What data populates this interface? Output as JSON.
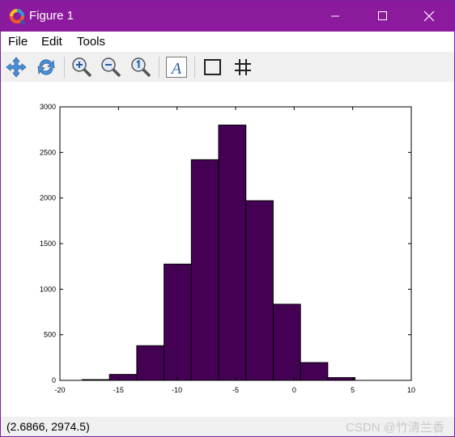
{
  "window": {
    "title": "Figure 1",
    "colors": {
      "titlebar": "#8b1a9c",
      "bar_fill": "#440154"
    }
  },
  "menu": {
    "file": "File",
    "edit": "Edit",
    "tools": "Tools"
  },
  "toolbar": {
    "icons": [
      "pan-icon",
      "rotate-icon",
      "zoom-in-icon",
      "zoom-out-icon",
      "zoom-reset-icon",
      "text-icon",
      "box-icon",
      "grid-icon"
    ]
  },
  "status": {
    "coordinates": "(2.6866, 2974.5)",
    "watermark": "CSDN @竹清兰香"
  },
  "chart_data": {
    "type": "bar",
    "title": "",
    "xlabel": "",
    "ylabel": "",
    "xlim": [
      -20,
      10
    ],
    "ylim": [
      0,
      3000
    ],
    "x_ticks": [
      "-20",
      "-15",
      "-10",
      "-5",
      "0",
      "5",
      "10"
    ],
    "y_ticks": [
      "0",
      "500",
      "1000",
      "1500",
      "2000",
      "2500",
      "3000"
    ],
    "bin_edges": [
      -18.1,
      -15.77,
      -13.44,
      -11.11,
      -8.78,
      -6.45,
      -4.12,
      -1.79,
      0.54,
      2.87,
      5.2
    ],
    "values": [
      8,
      65,
      380,
      1275,
      2420,
      2800,
      1970,
      835,
      195,
      30
    ],
    "grid": false
  }
}
